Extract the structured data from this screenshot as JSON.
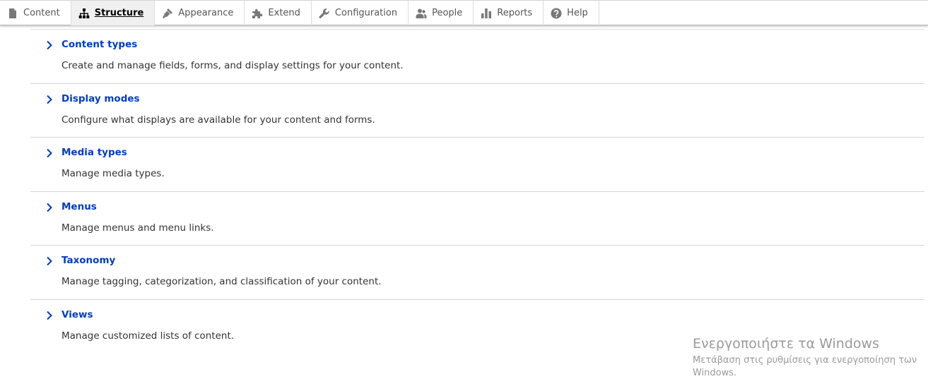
{
  "toolbar": {
    "tabs": [
      {
        "label": "Content",
        "icon": "file-icon",
        "active": false
      },
      {
        "label": "Structure",
        "icon": "sitemap-icon",
        "active": true
      },
      {
        "label": "Appearance",
        "icon": "paintbrush-icon",
        "active": false
      },
      {
        "label": "Extend",
        "icon": "puzzle-icon",
        "active": false
      },
      {
        "label": "Configuration",
        "icon": "wrench-icon",
        "active": false
      },
      {
        "label": "People",
        "icon": "people-icon",
        "active": false
      },
      {
        "label": "Reports",
        "icon": "bar-chart-icon",
        "active": false
      },
      {
        "label": "Help",
        "icon": "help-icon",
        "active": false
      }
    ]
  },
  "structure_list": [
    {
      "title": "Content types",
      "description": "Create and manage fields, forms, and display settings for your content."
    },
    {
      "title": "Display modes",
      "description": "Configure what displays are available for your content and forms."
    },
    {
      "title": "Media types",
      "description": "Manage media types."
    },
    {
      "title": "Menus",
      "description": "Manage menus and menu links."
    },
    {
      "title": "Taxonomy",
      "description": "Manage tagging, categorization, and classification of your content."
    },
    {
      "title": "Views",
      "description": "Manage customized lists of content."
    }
  ],
  "watermark": {
    "line1": "Ενεργοποιήστε τα Windows",
    "line2": "Μετάβαση στις ρυθμίσεις για ενεργοποίηση των",
    "line3": "Windows."
  },
  "colors": {
    "link": "#003cc5",
    "text": "#333333",
    "toolbar_text": "#565656",
    "active_tab_bg": "#f0f0f0",
    "divider": "#d6d6d6"
  }
}
